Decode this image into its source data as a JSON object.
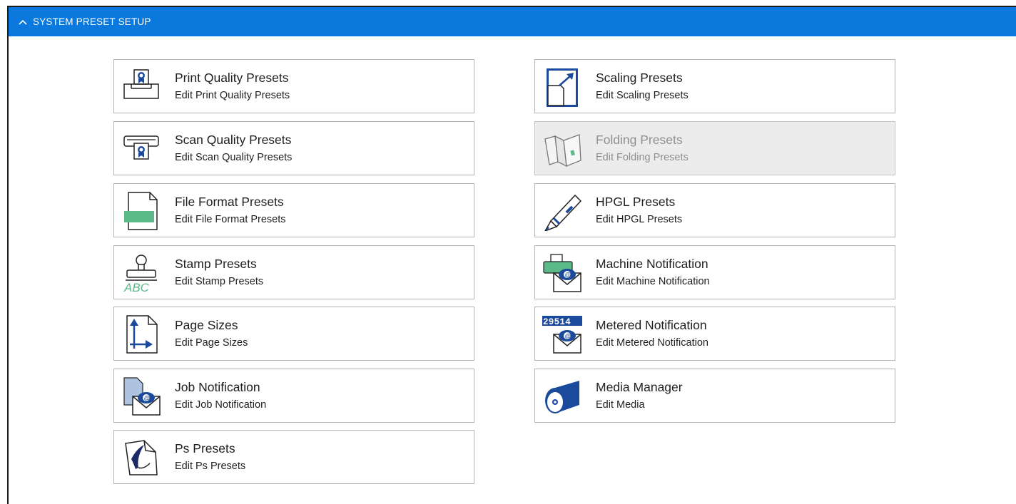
{
  "header": {
    "title": "SYSTEM PRESET SETUP",
    "chevron_icon": "chevron-up-icon",
    "color": "#0a78dc"
  },
  "left_column": [
    {
      "title": "Print Quality Presets",
      "subtitle": "Edit Print Quality Presets",
      "icon": "print-quality-icon"
    },
    {
      "title": "Scan Quality Presets",
      "subtitle": "Edit Scan Quality Presets",
      "icon": "scan-quality-icon"
    },
    {
      "title": "File Format Presets",
      "subtitle": "Edit File Format Presets",
      "icon": "file-format-icon"
    },
    {
      "title": "Stamp Presets",
      "subtitle": "Edit Stamp Presets",
      "icon": "stamp-icon",
      "icon_text": "ABC"
    },
    {
      "title": "Page Sizes",
      "subtitle": "Edit Page Sizes",
      "icon": "page-sizes-icon"
    },
    {
      "title": "Job Notification",
      "subtitle": "Edit Job Notification",
      "icon": "job-notification-icon"
    },
    {
      "title": "Ps Presets",
      "subtitle": "Edit Ps Presets",
      "icon": "ps-presets-icon"
    }
  ],
  "right_column": [
    {
      "title": "Scaling Presets",
      "subtitle": "Edit Scaling Presets",
      "icon": "scaling-icon"
    },
    {
      "title": "Folding Presets",
      "subtitle": "Edit Folding Presets",
      "icon": "folding-icon",
      "disabled": true
    },
    {
      "title": "HPGL Presets",
      "subtitle": "Edit HPGL Presets",
      "icon": "hpgl-pen-icon"
    },
    {
      "title": "Machine Notification",
      "subtitle": "Edit Machine Notification",
      "icon": "machine-notification-icon"
    },
    {
      "title": "Metered Notification",
      "subtitle": "Edit Metered Notification",
      "icon": "metered-notification-icon",
      "icon_text": "29514"
    },
    {
      "title": "Media Manager",
      "subtitle": "Edit Media",
      "icon": "media-roll-icon"
    }
  ],
  "colors": {
    "accent": "#0a78dc",
    "icon_blue": "#1b4a9c",
    "icon_green": "#5bb98a",
    "disabled_bg": "#ececec"
  }
}
